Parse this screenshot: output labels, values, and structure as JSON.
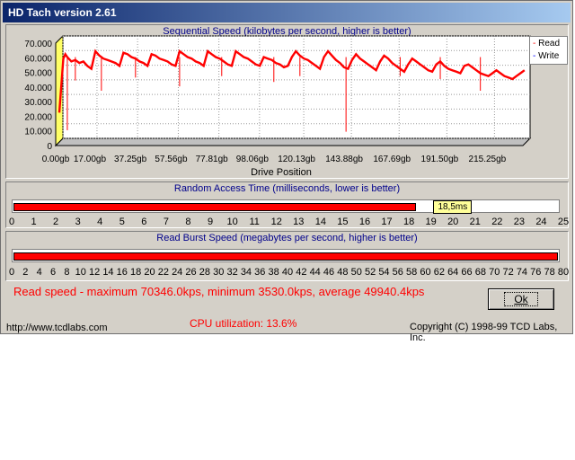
{
  "window": {
    "title": "HD Tach version 2.61"
  },
  "sequential": {
    "title": "Sequential Speed (kilobytes per second, higher is better)",
    "x_label": "Drive Position",
    "legend": [
      "Read",
      "Write"
    ]
  },
  "random": {
    "title": "Random Access Time (milliseconds, lower is better)",
    "value_label": "18,5ms",
    "value": 18.5,
    "max": 25,
    "ticks": [
      "0",
      "1",
      "2",
      "3",
      "4",
      "5",
      "6",
      "7",
      "8",
      "9",
      "10",
      "11",
      "12",
      "13",
      "14",
      "15",
      "16",
      "17",
      "18",
      "19",
      "20",
      "21",
      "22",
      "23",
      "24",
      "25"
    ]
  },
  "burst": {
    "title": "Read Burst Speed (megabytes per second, higher is better)",
    "value": 80,
    "max": 80,
    "ticks": [
      "0",
      "2",
      "4",
      "6",
      "8",
      "10",
      "12",
      "14",
      "16",
      "18",
      "20",
      "22",
      "24",
      "26",
      "28",
      "30",
      "32",
      "34",
      "36",
      "38",
      "40",
      "42",
      "44",
      "46",
      "48",
      "50",
      "52",
      "54",
      "56",
      "58",
      "60",
      "62",
      "64",
      "66",
      "68",
      "70",
      "72",
      "74",
      "76",
      "78",
      "80"
    ]
  },
  "summary": "Read speed - maximum 70346.0kps, minimum 3530.0kps, average 49940.4kps",
  "ok_label": "Ok",
  "url": "http://www.tcdlabs.com",
  "cpu": "CPU utilization: 13.6%",
  "copyright": "Copyright (C) 1998-99 TCD Labs, Inc.",
  "colors": {
    "read": "#ff0000",
    "title_text": "#00008b",
    "highlight": "#ffff99"
  },
  "chart_data": {
    "type": "line",
    "title": "Sequential Speed (kilobytes per second, higher is better)",
    "xlabel": "Drive Position",
    "ylabel": "",
    "x_ticks": [
      "0.00gb",
      "17.00gb",
      "37.25gb",
      "57.56gb",
      "77.81gb",
      "98.06gb",
      "120.13gb",
      "143.88gb",
      "167.69gb",
      "191.50gb",
      "215.25gb"
    ],
    "x_tick_values": [
      0.0,
      17.0,
      37.25,
      57.56,
      77.81,
      98.06,
      120.13,
      143.88,
      167.69,
      191.5,
      215.25
    ],
    "y_ticks": [
      "0",
      "10.000",
      "20.000",
      "30.000",
      "40.000",
      "50.000",
      "60.000",
      "70.000"
    ],
    "xlim": [
      0,
      233
    ],
    "ylim": [
      0,
      70000
    ],
    "grid": true,
    "legend_position": "top-right",
    "series": [
      {
        "name": "Read",
        "x": [
          0,
          2,
          3,
          4,
          6,
          8,
          10,
          12,
          14,
          16,
          17,
          18,
          20,
          22,
          24,
          26,
          28,
          30,
          32,
          34,
          36,
          38,
          40,
          42,
          44,
          46,
          48,
          50,
          52,
          54,
          56,
          58,
          60,
          62,
          64,
          66,
          68,
          70,
          72,
          74,
          76,
          78,
          80,
          82,
          84,
          86,
          88,
          90,
          92,
          94,
          96,
          98,
          100,
          102,
          104,
          106,
          108,
          110,
          112,
          114,
          116,
          118,
          120,
          122,
          124,
          126,
          128,
          130,
          132,
          134,
          136,
          138,
          140,
          142,
          144,
          146,
          148,
          150,
          152,
          154,
          156,
          158,
          160,
          162,
          164,
          166,
          168,
          170,
          172,
          174,
          176,
          178,
          180,
          182,
          184,
          186,
          188,
          190,
          192,
          194,
          196,
          198,
          200,
          202,
          204,
          206,
          208,
          210,
          212,
          214,
          216,
          218,
          220,
          222,
          224,
          226,
          228,
          230,
          232
        ],
        "y": [
          20000,
          57000,
          60000,
          58000,
          55000,
          56000,
          54000,
          55000,
          52000,
          50000,
          56000,
          62000,
          59000,
          57000,
          56000,
          55000,
          54000,
          52000,
          61000,
          60000,
          58000,
          57000,
          55000,
          54000,
          52000,
          60000,
          59000,
          57000,
          56000,
          55000,
          53000,
          52000,
          62000,
          60000,
          58000,
          57000,
          55000,
          54000,
          52000,
          62000,
          60000,
          58000,
          57000,
          55000,
          53000,
          52000,
          62000,
          60000,
          58000,
          57000,
          55000,
          53000,
          52000,
          58000,
          57000,
          56000,
          54000,
          53000,
          51000,
          52000,
          58000,
          62000,
          59000,
          57000,
          56000,
          54000,
          52000,
          50000,
          58000,
          62000,
          59000,
          56000,
          54000,
          51000,
          50000,
          56000,
          60000,
          57000,
          55000,
          53000,
          51000,
          49000,
          55000,
          59000,
          57000,
          54000,
          52000,
          50000,
          48000,
          53000,
          57000,
          55000,
          53000,
          51000,
          49000,
          48000,
          53000,
          55000,
          52000,
          50000,
          49000,
          48000,
          47000,
          52000,
          53000,
          51000,
          49000,
          47000,
          46000,
          45000,
          47000,
          49000,
          47000,
          45000,
          44000,
          43000,
          45000,
          47000,
          49000
        ],
        "dips": [
          [
            4,
            8000
          ],
          [
            8,
            42000
          ],
          [
            21,
            35000
          ],
          [
            38,
            44000
          ],
          [
            60,
            38000
          ],
          [
            81,
            45000
          ],
          [
            107,
            41000
          ],
          [
            120,
            45000
          ],
          [
            143,
            7000
          ],
          [
            170,
            45000
          ],
          [
            190,
            43000
          ],
          [
            210,
            35000
          ]
        ]
      }
    ]
  }
}
